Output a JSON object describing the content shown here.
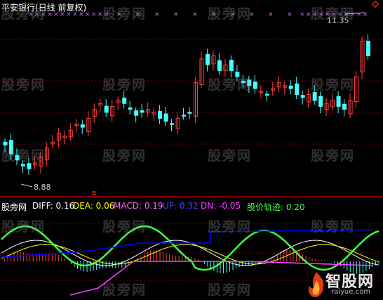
{
  "title": "平安银行(日线 前复权)",
  "high_label": "11.35",
  "low_label": "8.88",
  "watermark": "股旁网",
  "indicator": {
    "name": "股旁网",
    "diff": "DIFF: 0.16",
    "dea": "DEA: 0.06",
    "macd": "MACD: 0.19",
    "up": "UP: 0.32",
    "dn": "DN: -0.05",
    "track": "股价轨迹: 0.20"
  },
  "logo": {
    "text": "智股网",
    "url": "raiyue.com"
  },
  "colors": {
    "up": "#ff4040",
    "down": "#44ffff",
    "diff": "#ffffff",
    "dea": "#ffff00",
    "macd": "#ff66ff",
    "up_line": "#0000ff",
    "dn": "#ff40ff",
    "track": "#40ff40"
  },
  "chart_data": {
    "type": "candlestick",
    "price_range": [
      8.6,
      11.6
    ],
    "high": 11.35,
    "low": 8.88,
    "closes": [
      9.35,
      9.2,
      9.1,
      9.0,
      8.95,
      9.05,
      9.15,
      9.3,
      9.4,
      9.55,
      9.5,
      9.6,
      9.7,
      9.65,
      9.8,
      9.95,
      10.05,
      9.9,
      10.0,
      10.1,
      10.05,
      9.95,
      9.85,
      9.9,
      9.95,
      9.9,
      9.8,
      9.75,
      9.7,
      9.8,
      9.85,
      9.9,
      10.4,
      10.8,
      10.7,
      10.85,
      10.6,
      10.7,
      10.6,
      10.5,
      10.4,
      10.35,
      10.3,
      10.25,
      10.2,
      10.3,
      10.4,
      10.35,
      10.3,
      10.2,
      10.15,
      10.2,
      10.1,
      10.0,
      10.05,
      10.1,
      10.0,
      9.95,
      10.1,
      10.5,
      11.1,
      10.85
    ]
  }
}
